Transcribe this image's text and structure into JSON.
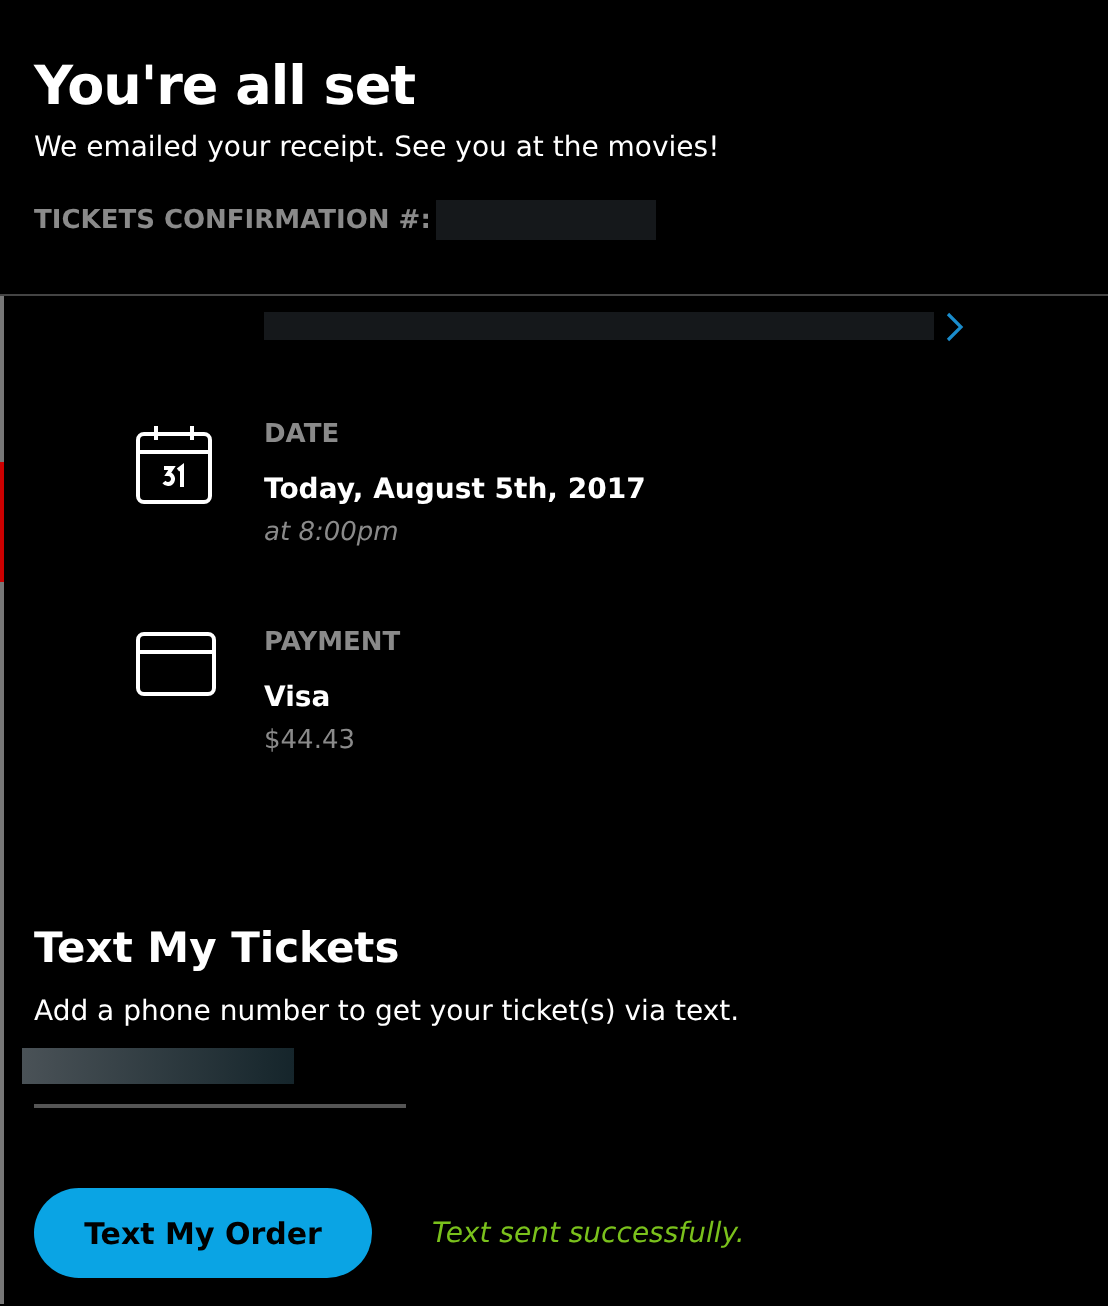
{
  "header": {
    "title": "You're all set",
    "subtitle": "We emailed your receipt. See you at the movies!",
    "confirmation_label": "TICKETS CONFIRMATION #:"
  },
  "details": [
    {
      "kind": "date",
      "label": "DATE",
      "value": "Today, August 5th, 2017",
      "note": "at 8:00pm"
    },
    {
      "kind": "payment",
      "label": "PAYMENT",
      "value": "Visa",
      "note": "$44.43"
    }
  ],
  "text_tickets": {
    "title": "Text My Tickets",
    "description": "Add a phone number to get your ticket(s) via text.",
    "button": "Text My Order",
    "status": "Text sent successfully."
  }
}
